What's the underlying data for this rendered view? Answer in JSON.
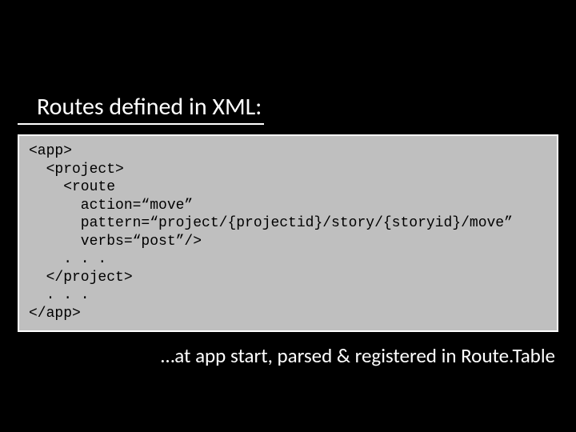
{
  "heading": "Routes defined in XML:",
  "code": {
    "l1": "<app>",
    "l2": "  <project>",
    "l3": "    <route",
    "l4": "      action=“move”",
    "l5": "      pattern=“project/{projectid}/story/{storyid}/move”",
    "l6": "      verbs=“post”/>",
    "l7": "    . . .",
    "l8": "  </project>",
    "l9": "  . . .",
    "l10": "</app>"
  },
  "footer": "…at app start, parsed & registered in Route.Table"
}
